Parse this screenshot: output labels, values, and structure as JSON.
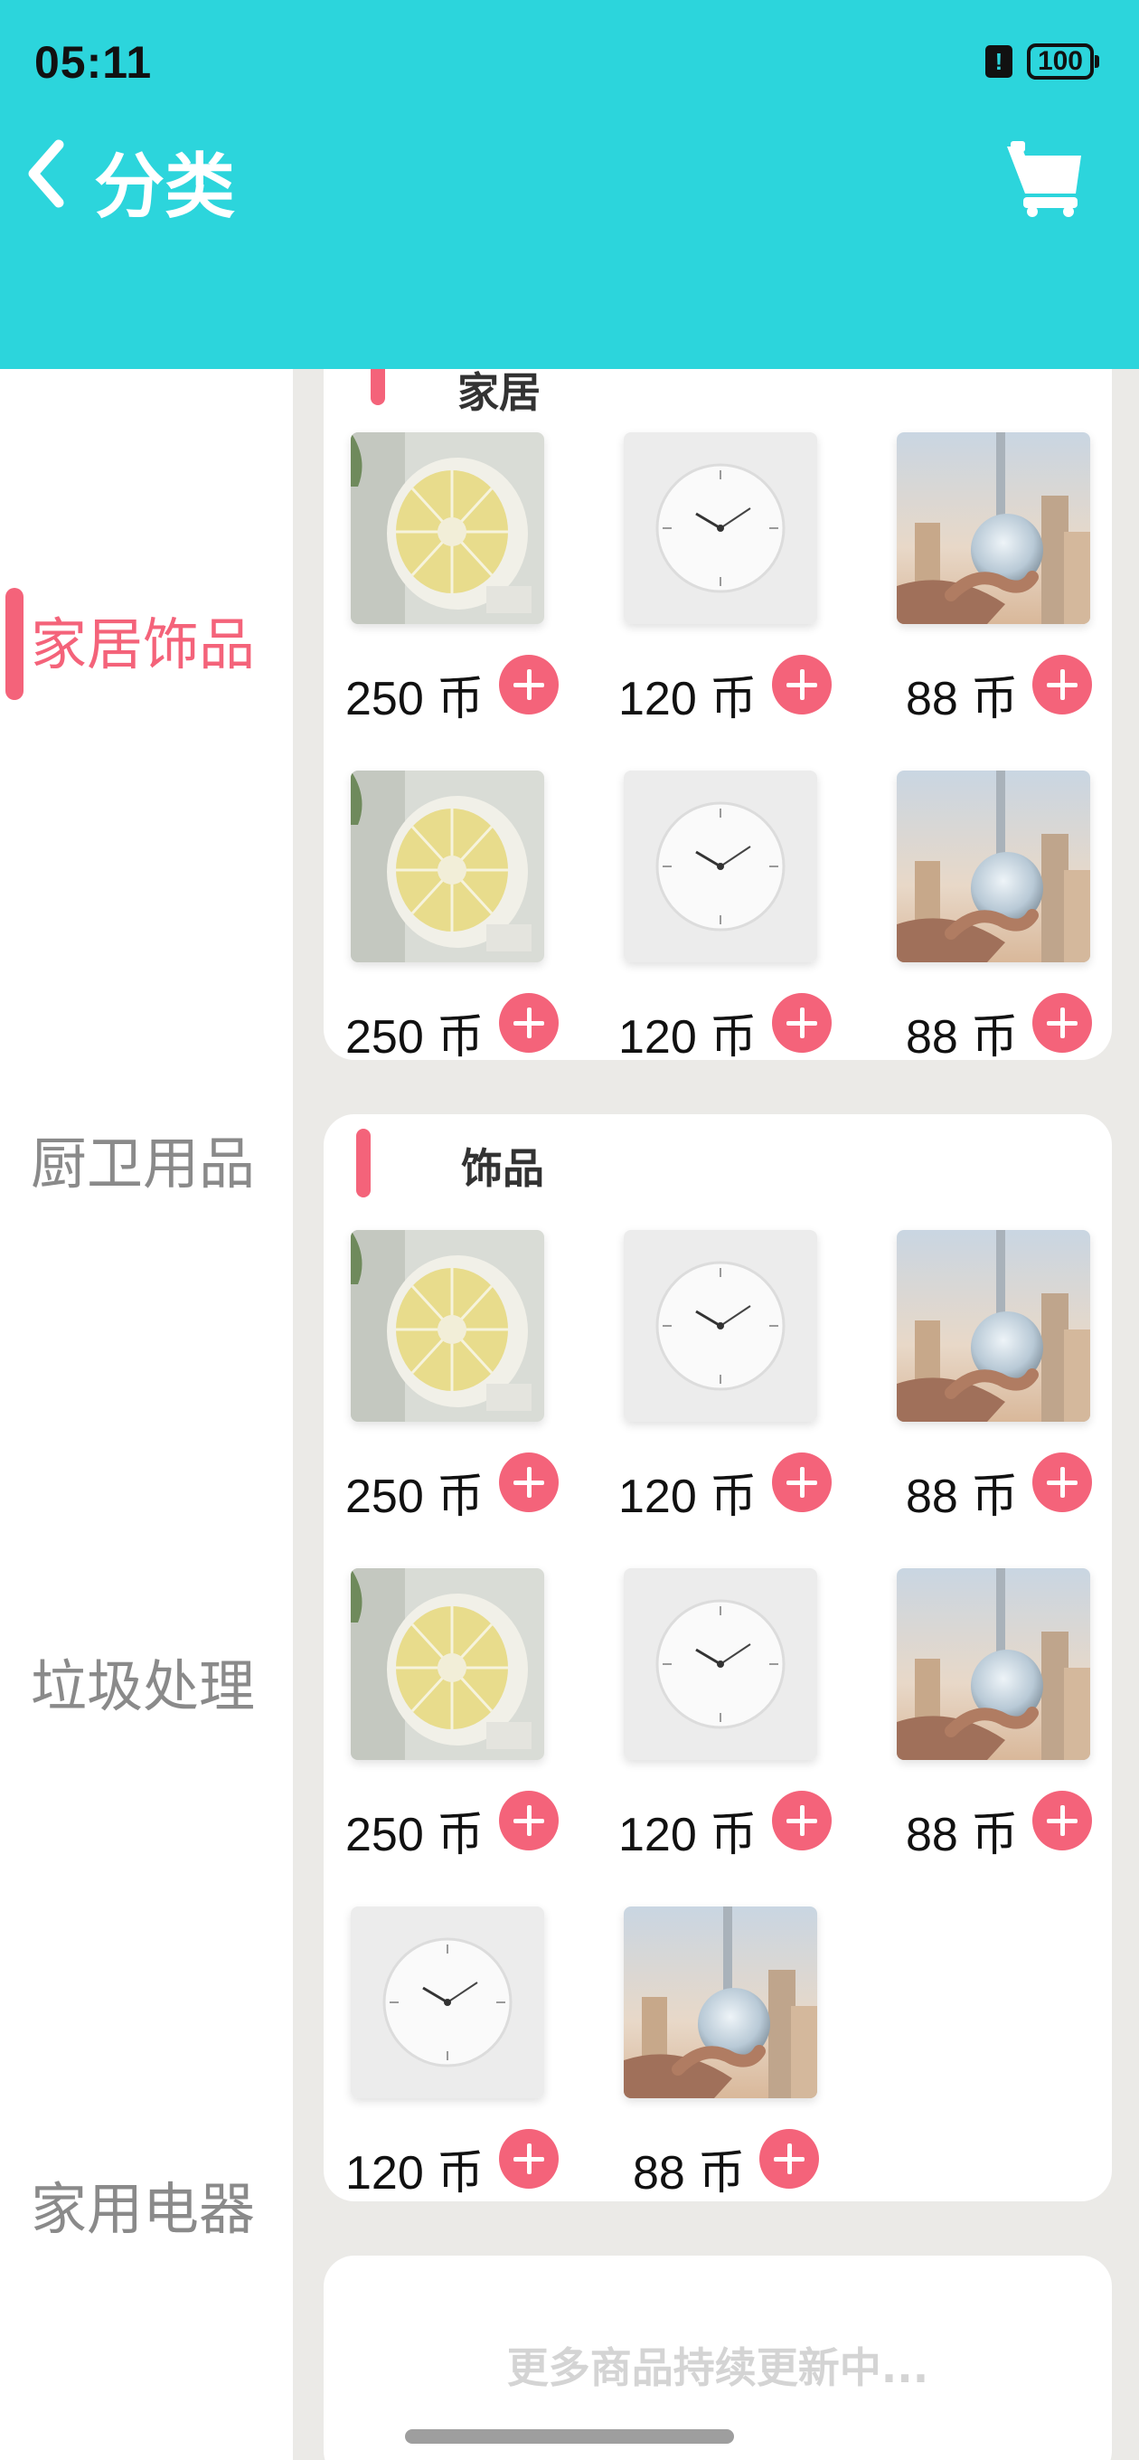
{
  "status_bar": {
    "time": "05:11",
    "alert_glyph": "!",
    "battery": "100"
  },
  "header": {
    "title": "分类",
    "back_icon": "chevron-left-icon",
    "cart_icon": "cart-icon"
  },
  "sidebar": {
    "items": [
      {
        "label": "家居饰品",
        "active": true
      },
      {
        "label": "厨卫用品",
        "active": false
      },
      {
        "label": "垃圾处理",
        "active": false
      },
      {
        "label": "家用电器",
        "active": false
      }
    ]
  },
  "sections": [
    {
      "title": "家居",
      "products": [
        {
          "image": "desk-fan",
          "price": "250 币"
        },
        {
          "image": "wall-clock",
          "price": "120 币"
        },
        {
          "image": "crystal-ball-city",
          "price": "88 币"
        },
        {
          "image": "desk-fan",
          "price": "250 币"
        },
        {
          "image": "wall-clock",
          "price": "120 币"
        },
        {
          "image": "crystal-ball-city",
          "price": "88 币"
        }
      ]
    },
    {
      "title": "饰品",
      "products": [
        {
          "image": "desk-fan",
          "price": "250 币"
        },
        {
          "image": "wall-clock",
          "price": "120 币"
        },
        {
          "image": "crystal-ball-city",
          "price": "88 币"
        },
        {
          "image": "desk-fan",
          "price": "250 币"
        },
        {
          "image": "wall-clock",
          "price": "120 币"
        },
        {
          "image": "crystal-ball-city",
          "price": "88 币"
        },
        {
          "image": "wall-clock",
          "price": "120 币"
        },
        {
          "image": "crystal-ball-city",
          "price": "88 币"
        }
      ]
    }
  ],
  "footer": {
    "more_text": "更多商品持续更新中..."
  },
  "colors": {
    "header_bg": "#2cd5dc",
    "accent": "#f4637a",
    "page_bg": "#ebeae7"
  }
}
